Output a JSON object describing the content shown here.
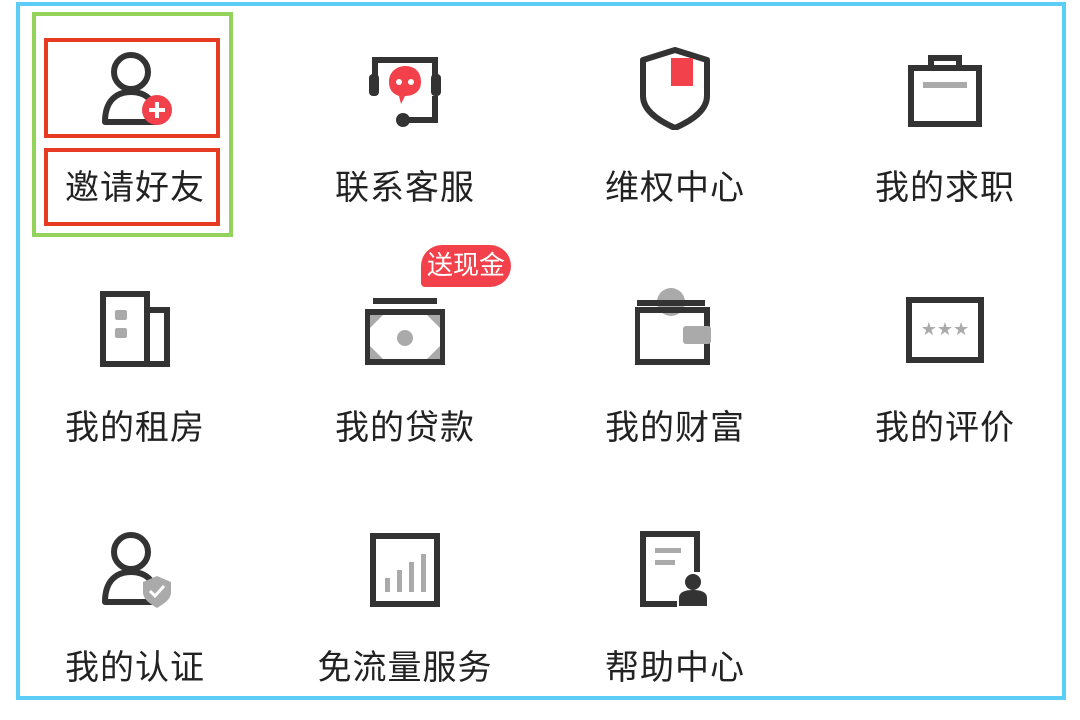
{
  "accent_color": "#f2414a",
  "frame_color": "#5ccdf7",
  "highlight_colors": {
    "outer": "#93d35c",
    "inner": "#e53b22"
  },
  "menu": {
    "items": [
      {
        "label": "邀请好友",
        "icon": "invite-user-icon"
      },
      {
        "label": "联系客服",
        "icon": "customer-service-icon"
      },
      {
        "label": "维权中心",
        "icon": "shield-icon"
      },
      {
        "label": "我的求职",
        "icon": "briefcase-icon"
      },
      {
        "label": "我的租房",
        "icon": "rental-building-icon"
      },
      {
        "label": "我的贷款",
        "icon": "cash-icon",
        "badge": "送现金"
      },
      {
        "label": "我的财富",
        "icon": "wallet-icon"
      },
      {
        "label": "我的评价",
        "icon": "rating-stars-icon"
      },
      {
        "label": "我的认证",
        "icon": "verified-user-icon"
      },
      {
        "label": "免流量服务",
        "icon": "data-chart-icon"
      },
      {
        "label": "帮助中心",
        "icon": "help-document-icon"
      }
    ]
  }
}
